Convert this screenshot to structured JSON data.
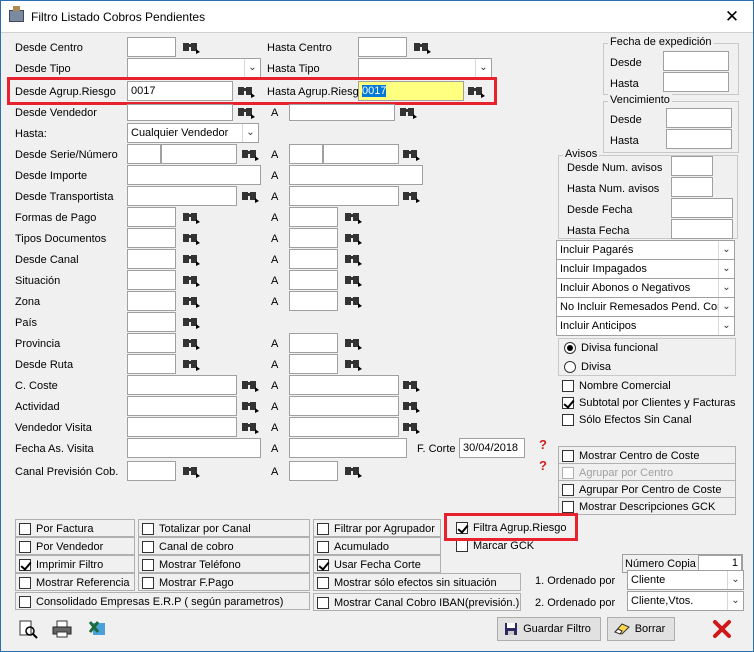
{
  "window": {
    "title": "Filtro Listado Cobros Pendientes",
    "close": "✕"
  },
  "left": {
    "desde_centro": {
      "label": "Desde Centro",
      "value": ""
    },
    "hasta_centro": {
      "label": "Hasta Centro",
      "value": ""
    },
    "desde_tipo": {
      "label": "Desde Tipo",
      "value": ""
    },
    "hasta_tipo": {
      "label": "Hasta Tipo",
      "value": ""
    },
    "desde_agrup": {
      "label": "Desde Agrup.Riesgo",
      "value": "0017"
    },
    "hasta_agrup": {
      "label": "Hasta Agrup.Riesg",
      "value": "0017"
    },
    "desde_vendedor": {
      "label": "Desde Vendedor",
      "value": ""
    },
    "hasta": {
      "label": "Hasta:",
      "value": "Cualquier Vendedor"
    },
    "desde_serie": {
      "label": "Desde Serie/Número"
    },
    "desde_importe": {
      "label": "Desde Importe"
    },
    "desde_transportista": {
      "label": "Desde Transportista"
    },
    "formas_pago": {
      "label": "Formas de Pago"
    },
    "tipos_documentos": {
      "label": "Tipos Documentos"
    },
    "desde_canal": {
      "label": "Desde Canal"
    },
    "situacion": {
      "label": "Situación"
    },
    "zona": {
      "label": "Zona"
    },
    "pais": {
      "label": "País"
    },
    "provincia": {
      "label": "Provincia"
    },
    "desde_ruta": {
      "label": "Desde Ruta"
    },
    "c_coste": {
      "label": "C. Coste"
    },
    "actividad": {
      "label": "Actividad"
    },
    "vendedor_visita": {
      "label": "Vendedor Visita"
    },
    "fecha_as_visita": {
      "label": "Fecha As. Visita"
    },
    "canal_prevision": {
      "label": "Canal Previsión Cob."
    },
    "a_label": "A",
    "f_corte": {
      "label": "F. Corte",
      "value": "30/04/2018"
    }
  },
  "right": {
    "fecha_expedicion": {
      "title": "Fecha de expedición",
      "desde": "Desde",
      "hasta": "Hasta"
    },
    "vencimiento": {
      "title": "Vencimiento",
      "desde": "Desde",
      "hasta": "Hasta"
    },
    "avisos": {
      "title": "Avisos",
      "desde_num": "Desde Num. avisos",
      "hasta_num": "Hasta Num. avisos",
      "desde_fecha": "Desde Fecha",
      "hasta_fecha": "Hasta Fecha"
    },
    "selects": [
      "Incluir Pagarés",
      "Incluir Impagados",
      "Incluir Abonos o Negativos",
      "No Incluir Remesados Pend. Cor",
      "Incluir Anticipos"
    ],
    "divisa_funcional": "Divisa funcional",
    "divisa": "Divisa",
    "nombre_comercial": "Nombre Comercial",
    "subtotal": "Subtotal por Clientes y Facturas",
    "solo_efectos": "Sólo Efectos Sin Canal",
    "mostrar_centro": "Mostrar Centro de Coste",
    "agrupar_centro": "Agrupar por Centro",
    "agrupar_por_centro": "Agrupar Por Centro de Coste",
    "mostrar_desc": "Mostrar Descripciones GCK"
  },
  "bottom": {
    "col1": [
      "Por Factura",
      "Por Vendedor",
      "Imprimir Filtro",
      "Mostrar Referencia"
    ],
    "col2": [
      "Totalizar por Canal",
      "Canal de cobro",
      "Mostrar Teléfono",
      "Mostrar F.Pago"
    ],
    "col3": [
      "Filtrar por Agrupador",
      "Acumulado",
      "Usar Fecha Corte",
      "Mostrar sólo efectos sin situación"
    ],
    "consolidado": "Consolidado Empresas E.R.P ( según parametros)",
    "canal_iban": "Mostrar Canal Cobro IBAN(previsión.)",
    "filtra_agrup": "Filtra Agrup.Riesgo",
    "marcar_gck": "Marcar GCK",
    "numero_copias": {
      "label": "Número Copia",
      "value": "1"
    },
    "ordenado1": {
      "label": "1. Ordenado por",
      "value": "Cliente"
    },
    "ordenado2": {
      "label": "2. Ordenado por",
      "value": "Cliente,Vtos."
    }
  },
  "toolbar": {
    "guardar": "Guardar Filtro",
    "borrar": "Borrar"
  },
  "colors": {
    "highlight_border": "#e8212e",
    "selected_text_bg": "#0078d7",
    "yellow_field": "#ffff80"
  }
}
